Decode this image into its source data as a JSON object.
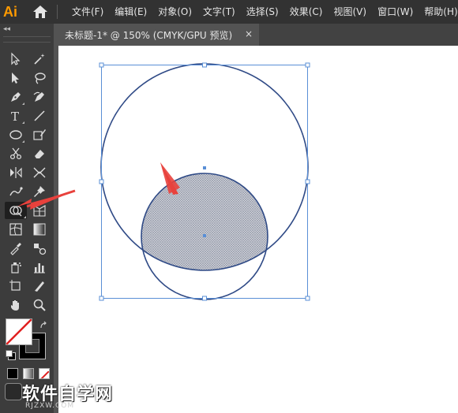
{
  "app": {
    "logo": "Ai"
  },
  "menu": {
    "items": [
      "文件(F)",
      "编辑(E)",
      "对象(O)",
      "文字(T)",
      "选择(S)",
      "效果(C)",
      "视图(V)",
      "窗口(W)",
      "帮助(H)"
    ]
  },
  "tools_panel": {
    "collapse_label": "◂◂",
    "tools": [
      "selection-tool",
      "direct-selection-tool",
      "group-selection-tool",
      "lasso-tool",
      "pen-tool",
      "curvature-tool",
      "type-tool",
      "line-segment-tool",
      "ellipse-tool",
      "paintbrush-tool",
      "scissors-tool",
      "eraser-tool",
      "reflect-tool",
      "width-tool",
      "puppet-warp-tool",
      "pin-tool",
      "shape-builder-tool",
      "perspective-grid-tool",
      "mesh-tool",
      "gradient-tool",
      "eyedropper-tool",
      "blend-tool",
      "symbol-sprayer-tool",
      "column-graph-tool",
      "artboard-tool",
      "slice-tool",
      "hand-tool",
      "zoom-tool"
    ],
    "selected_tool": "shape-builder-tool"
  },
  "document_tab": {
    "title": "未标题-1* @ 150% (CMYK/GPU 预览)",
    "close_label": "×"
  },
  "colors": {
    "menubar_bg": "#323232",
    "panel_bg": "#3c3c3c",
    "workspace_bg": "#535353",
    "stroke_color": "#2f4a86",
    "selection_color": "#5a8fd6",
    "arrow_color": "#e8413c",
    "logo_color": "#ff9a00"
  },
  "watermark": {
    "main": "软件自学网",
    "sub": "RJZXW.COM"
  }
}
